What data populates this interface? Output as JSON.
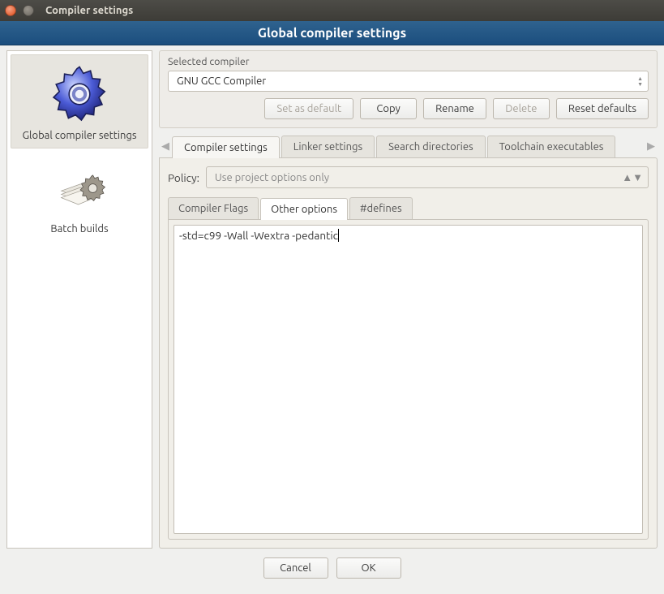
{
  "window": {
    "title": "Compiler settings"
  },
  "banner": "Global compiler settings",
  "sidebar": {
    "global": "Global compiler settings",
    "batch": "Batch builds"
  },
  "selcomp": {
    "label": "Selected compiler",
    "value": "GNU GCC Compiler",
    "btn_setdefault": "Set as default",
    "btn_copy": "Copy",
    "btn_rename": "Rename",
    "btn_delete": "Delete",
    "btn_reset": "Reset defaults"
  },
  "tabs": {
    "compiler": "Compiler settings",
    "linker": "Linker settings",
    "search": "Search directories",
    "toolchain": "Toolchain executables"
  },
  "policy": {
    "label": "Policy:",
    "value": "Use project options only"
  },
  "subtabs": {
    "flags": "Compiler Flags",
    "other": "Other options",
    "defines": "#defines"
  },
  "other_options_text": "-std=c99 -Wall -Wextra -pedantic",
  "footer": {
    "cancel": "Cancel",
    "ok": "OK"
  }
}
